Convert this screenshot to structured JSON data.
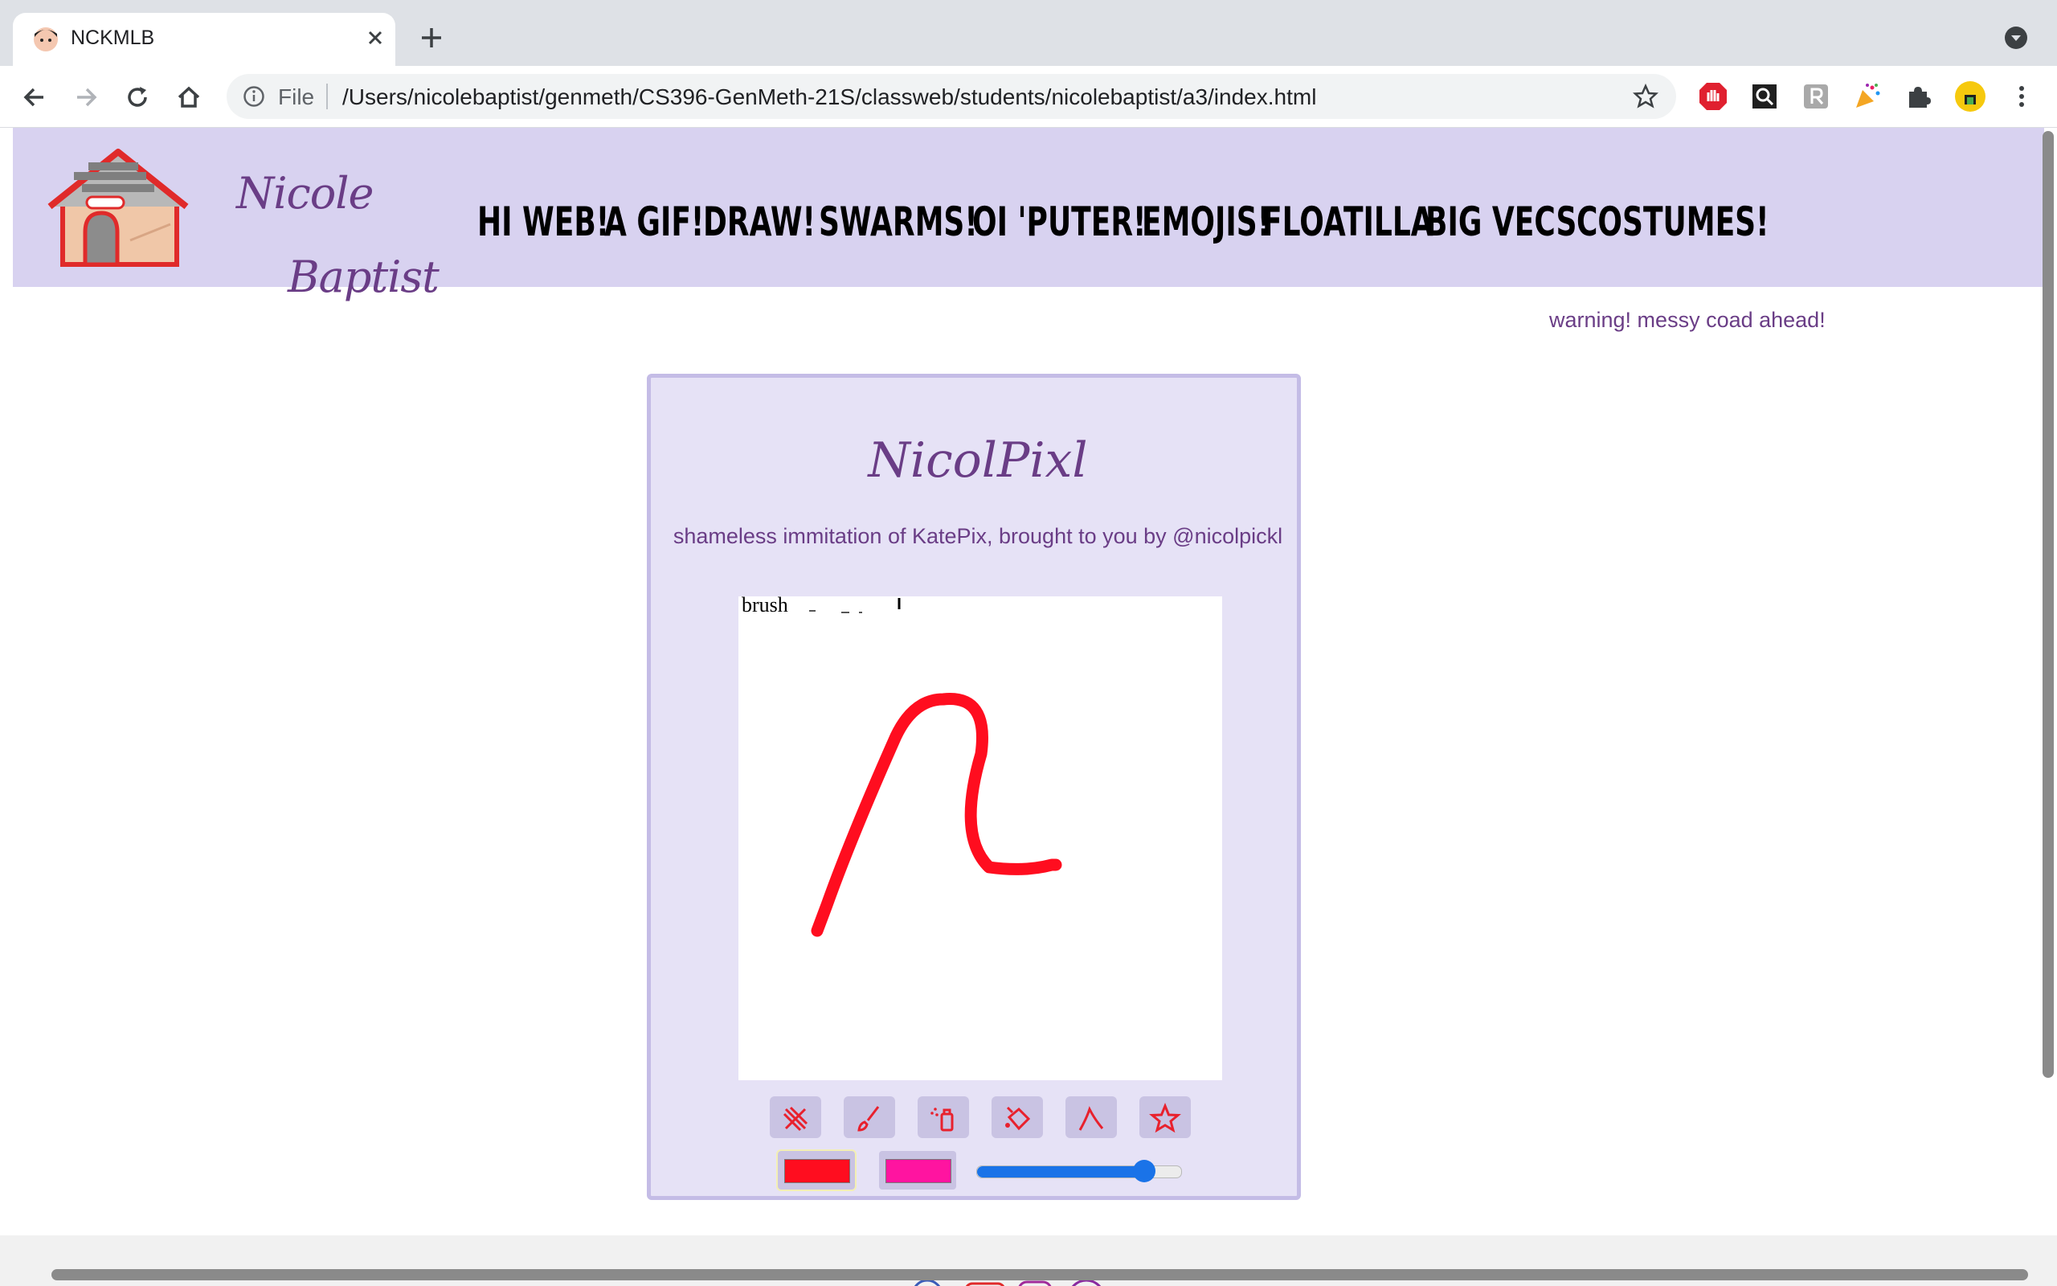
{
  "browser": {
    "tab_title": "NCKMLB",
    "scheme_label": "File",
    "url": "/Users/nicolebaptist/genmeth/CS396-GenMeth-21S/classweb/students/nicolebaptist/a3/index.html"
  },
  "site": {
    "name_first": "Nicole",
    "name_last": "Baptist",
    "nav": [
      "HI WEB!",
      "A GIF!",
      "DRAW!",
      "SWARMS!",
      "OI 'PUTER!",
      "EMOJIS!",
      "FLOATILLA",
      "BIG VECS",
      "COSTUMES!"
    ],
    "warning": "warning! messy coad ahead!"
  },
  "app": {
    "title": "NicolPixl",
    "subtitle": "shameless immitation of KatePix, brought to you by @nicolpickl",
    "canvas_label": "brush",
    "tools": [
      "eraser-icon",
      "brush-icon",
      "spray-icon",
      "bucket-icon",
      "line-icon",
      "star-icon"
    ],
    "colors": {
      "primary": "#ff0d1f",
      "secondary": "#ff14a0",
      "stroke": "#ff0d1f",
      "accent": "#6a3d86"
    },
    "brush_size_fraction": 0.82
  }
}
